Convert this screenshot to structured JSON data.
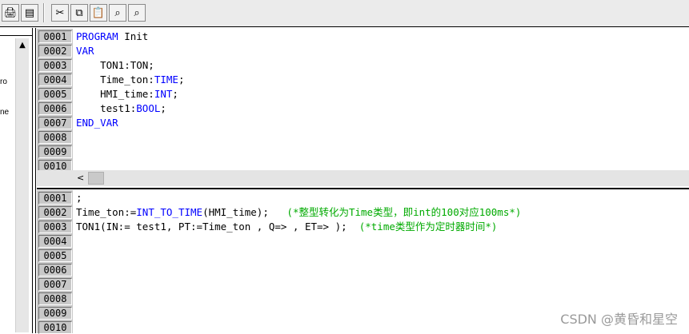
{
  "toolbar": {
    "buttons": [
      {
        "icon": "print-preview-icon",
        "glyph": "🖨"
      },
      {
        "icon": "print-icon",
        "glyph": "▤"
      },
      {
        "icon": "cut-icon",
        "glyph": "✂"
      },
      {
        "icon": "copy-icon",
        "glyph": "⧉"
      },
      {
        "icon": "paste-icon",
        "glyph": "📋"
      },
      {
        "icon": "find-icon",
        "glyph": "⌕"
      },
      {
        "icon": "find-next-icon",
        "glyph": "⌕"
      }
    ]
  },
  "left_pane": {
    "snippets": [
      "ro",
      "ne"
    ]
  },
  "declaration": {
    "line_numbers": [
      "0001",
      "0002",
      "0003",
      "0004",
      "0005",
      "0006",
      "0007",
      "0008",
      "0009",
      "0010"
    ],
    "lines": [
      {
        "parts": [
          {
            "t": "PROGRAM",
            "k": "kw"
          },
          {
            "t": " Init",
            "k": ""
          }
        ]
      },
      {
        "parts": [
          {
            "t": "VAR",
            "k": "kw"
          }
        ]
      },
      {
        "parts": [
          {
            "t": "    TON1:TON;",
            "k": ""
          }
        ]
      },
      {
        "parts": [
          {
            "t": "    Time_ton:",
            "k": ""
          },
          {
            "t": "TIME",
            "k": "kw"
          },
          {
            "t": ";",
            "k": ""
          }
        ]
      },
      {
        "parts": [
          {
            "t": "    HMI_time:",
            "k": ""
          },
          {
            "t": "INT",
            "k": "kw"
          },
          {
            "t": ";",
            "k": ""
          }
        ]
      },
      {
        "parts": [
          {
            "t": "    test1:",
            "k": ""
          },
          {
            "t": "BOOL",
            "k": "kw"
          },
          {
            "t": ";",
            "k": ""
          }
        ]
      },
      {
        "parts": [
          {
            "t": "END_VAR",
            "k": "kw"
          }
        ]
      }
    ]
  },
  "scrollbar": {
    "left_arrow": "<"
  },
  "body": {
    "line_numbers": [
      "0001",
      "0002",
      "0003",
      "0004",
      "0005",
      "0006",
      "0007",
      "0008",
      "0009",
      "0010"
    ],
    "lines": [
      {
        "parts": [
          {
            "t": ";",
            "k": ""
          }
        ]
      },
      {
        "parts": [
          {
            "t": "Time_ton:=",
            "k": ""
          },
          {
            "t": "INT_TO_TIME",
            "k": "kw"
          },
          {
            "t": "(HMI_time);   ",
            "k": ""
          },
          {
            "t": "(*整型转化为Time类型，即int的100对应100ms*)",
            "k": "cm"
          }
        ]
      },
      {
        "parts": [
          {
            "t": "TON1(IN:= test1, PT:=Time_ton , Q=> , ET=> );  ",
            "k": ""
          },
          {
            "t": "(*time类型作为定时器时间*)",
            "k": "cm"
          }
        ]
      }
    ]
  },
  "watermark": "CSDN @黄昏和星空"
}
